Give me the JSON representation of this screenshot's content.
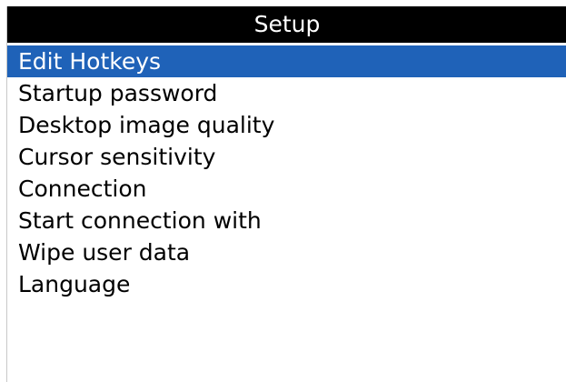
{
  "screen": {
    "title": "Setup"
  },
  "menu": {
    "items": [
      {
        "label": "Edit Hotkeys",
        "selected": true
      },
      {
        "label": "Startup password",
        "selected": false
      },
      {
        "label": "Desktop image quality",
        "selected": false
      },
      {
        "label": "Cursor sensitivity",
        "selected": false
      },
      {
        "label": "Connection",
        "selected": false
      },
      {
        "label": "Start connection with",
        "selected": false
      },
      {
        "label": "Wipe user data",
        "selected": false
      },
      {
        "label": "Language",
        "selected": false
      }
    ]
  },
  "colors": {
    "title_bar_background": "#000000",
    "title_text": "#ffffff",
    "selection_highlight": "#1f62b8",
    "background": "#ffffff",
    "text": "#000000"
  }
}
